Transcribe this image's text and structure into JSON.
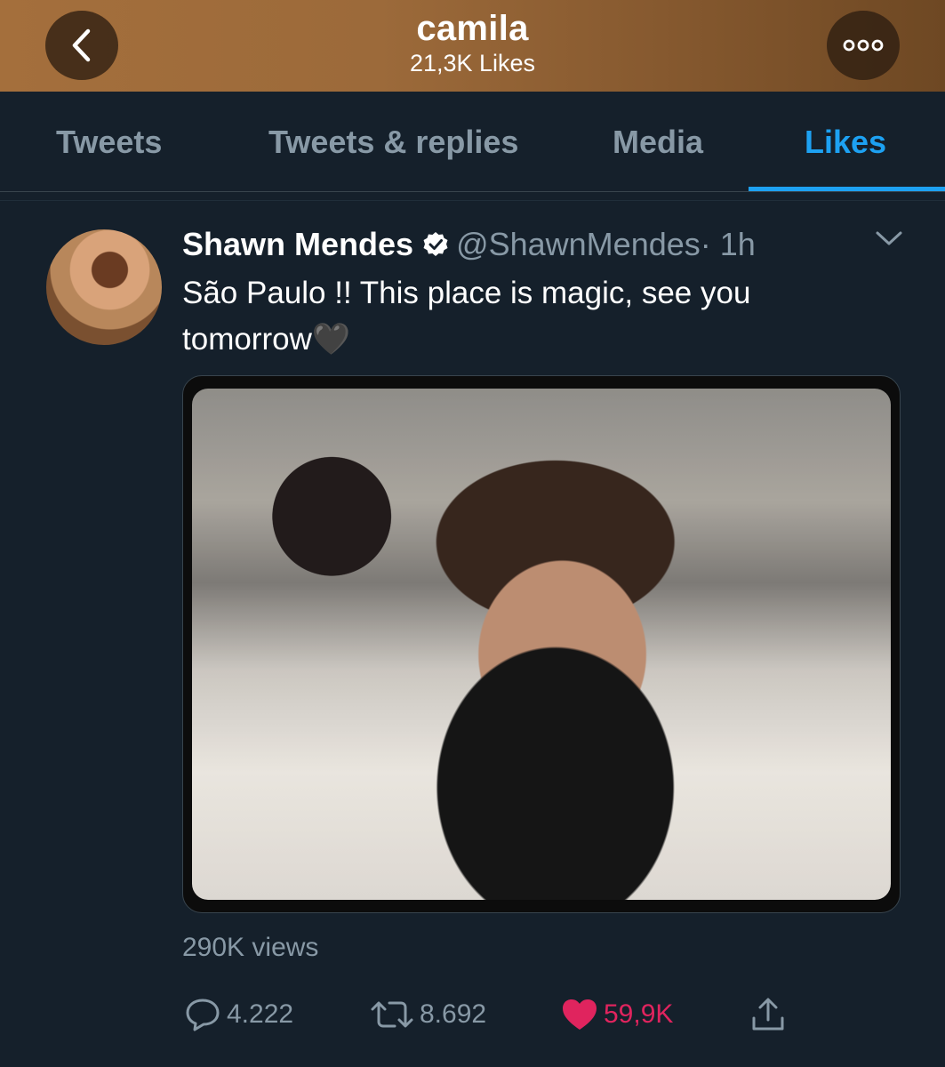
{
  "header": {
    "title": "camila",
    "subtitle": "21,3K Likes",
    "back_icon": "chevron-left-icon",
    "more_icon": "more-horizontal-icon",
    "gradient_color": "#a46f3c"
  },
  "tabs": [
    {
      "label": "Tweets",
      "active": false
    },
    {
      "label": "Tweets & replies",
      "active": false
    },
    {
      "label": "Media",
      "active": false
    },
    {
      "label": "Likes",
      "active": true
    }
  ],
  "tweet": {
    "author_name": "Shawn Mendes",
    "verified": true,
    "handle": "@ShawnMendes",
    "time": " · 1h",
    "text": "São Paulo !! This place is magic, see you tomorrow🖤",
    "media_type": "video",
    "views": "290K views",
    "actions": {
      "replies": "4.222",
      "retweets": "8.692",
      "likes": "59,9K",
      "liked": true
    }
  },
  "colors": {
    "background": "#15202b",
    "accent": "#1da1f2",
    "muted": "#8899a6",
    "like": "#e0245e"
  }
}
